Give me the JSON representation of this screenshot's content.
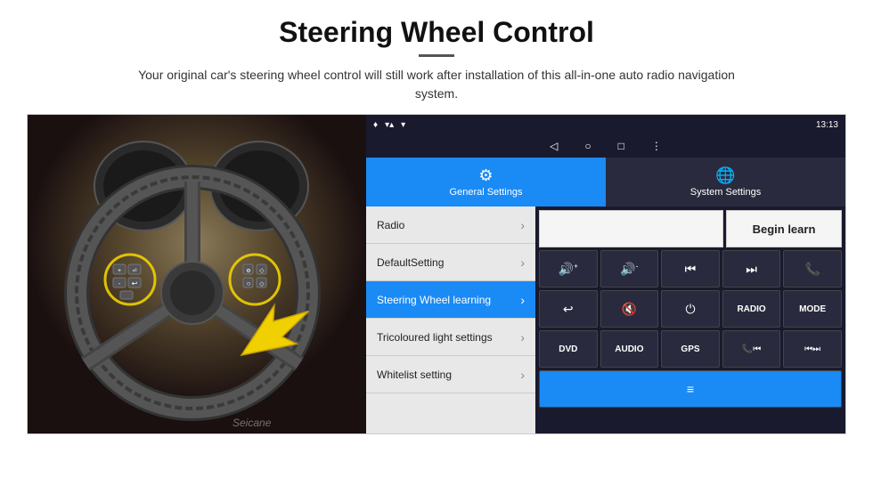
{
  "page": {
    "title": "Steering Wheel Control",
    "subtitle": "Your original car's steering wheel control will still work after installation of this all-in-one auto radio navigation system."
  },
  "status_bar": {
    "signal_icon": "▾▴",
    "wifi_icon": "▾",
    "time": "13:13"
  },
  "nav": {
    "back": "◁",
    "home": "○",
    "square": "□",
    "menu": "⋮"
  },
  "tabs": {
    "general": {
      "label": "General Settings",
      "icon": "⚙"
    },
    "system": {
      "label": "System Settings",
      "icon": "🌐"
    }
  },
  "menu_items": [
    {
      "label": "Radio",
      "active": false
    },
    {
      "label": "DefaultSetting",
      "active": false
    },
    {
      "label": "Steering Wheel learning",
      "active": true
    },
    {
      "label": "Tricoloured light settings",
      "active": false
    },
    {
      "label": "Whitelist setting",
      "active": false
    }
  ],
  "buttons": {
    "begin_learn": "Begin learn",
    "row1": [
      "🔊+",
      "🔊-",
      "⏮",
      "⏭",
      "📞"
    ],
    "row2": [
      "↩",
      "🔇",
      "⏻",
      "RADIO",
      "MODE"
    ],
    "row3": [
      "DVD",
      "AUDIO",
      "GPS",
      "📞⏮",
      "⏮⏭"
    ]
  },
  "watermark": "Seicane"
}
